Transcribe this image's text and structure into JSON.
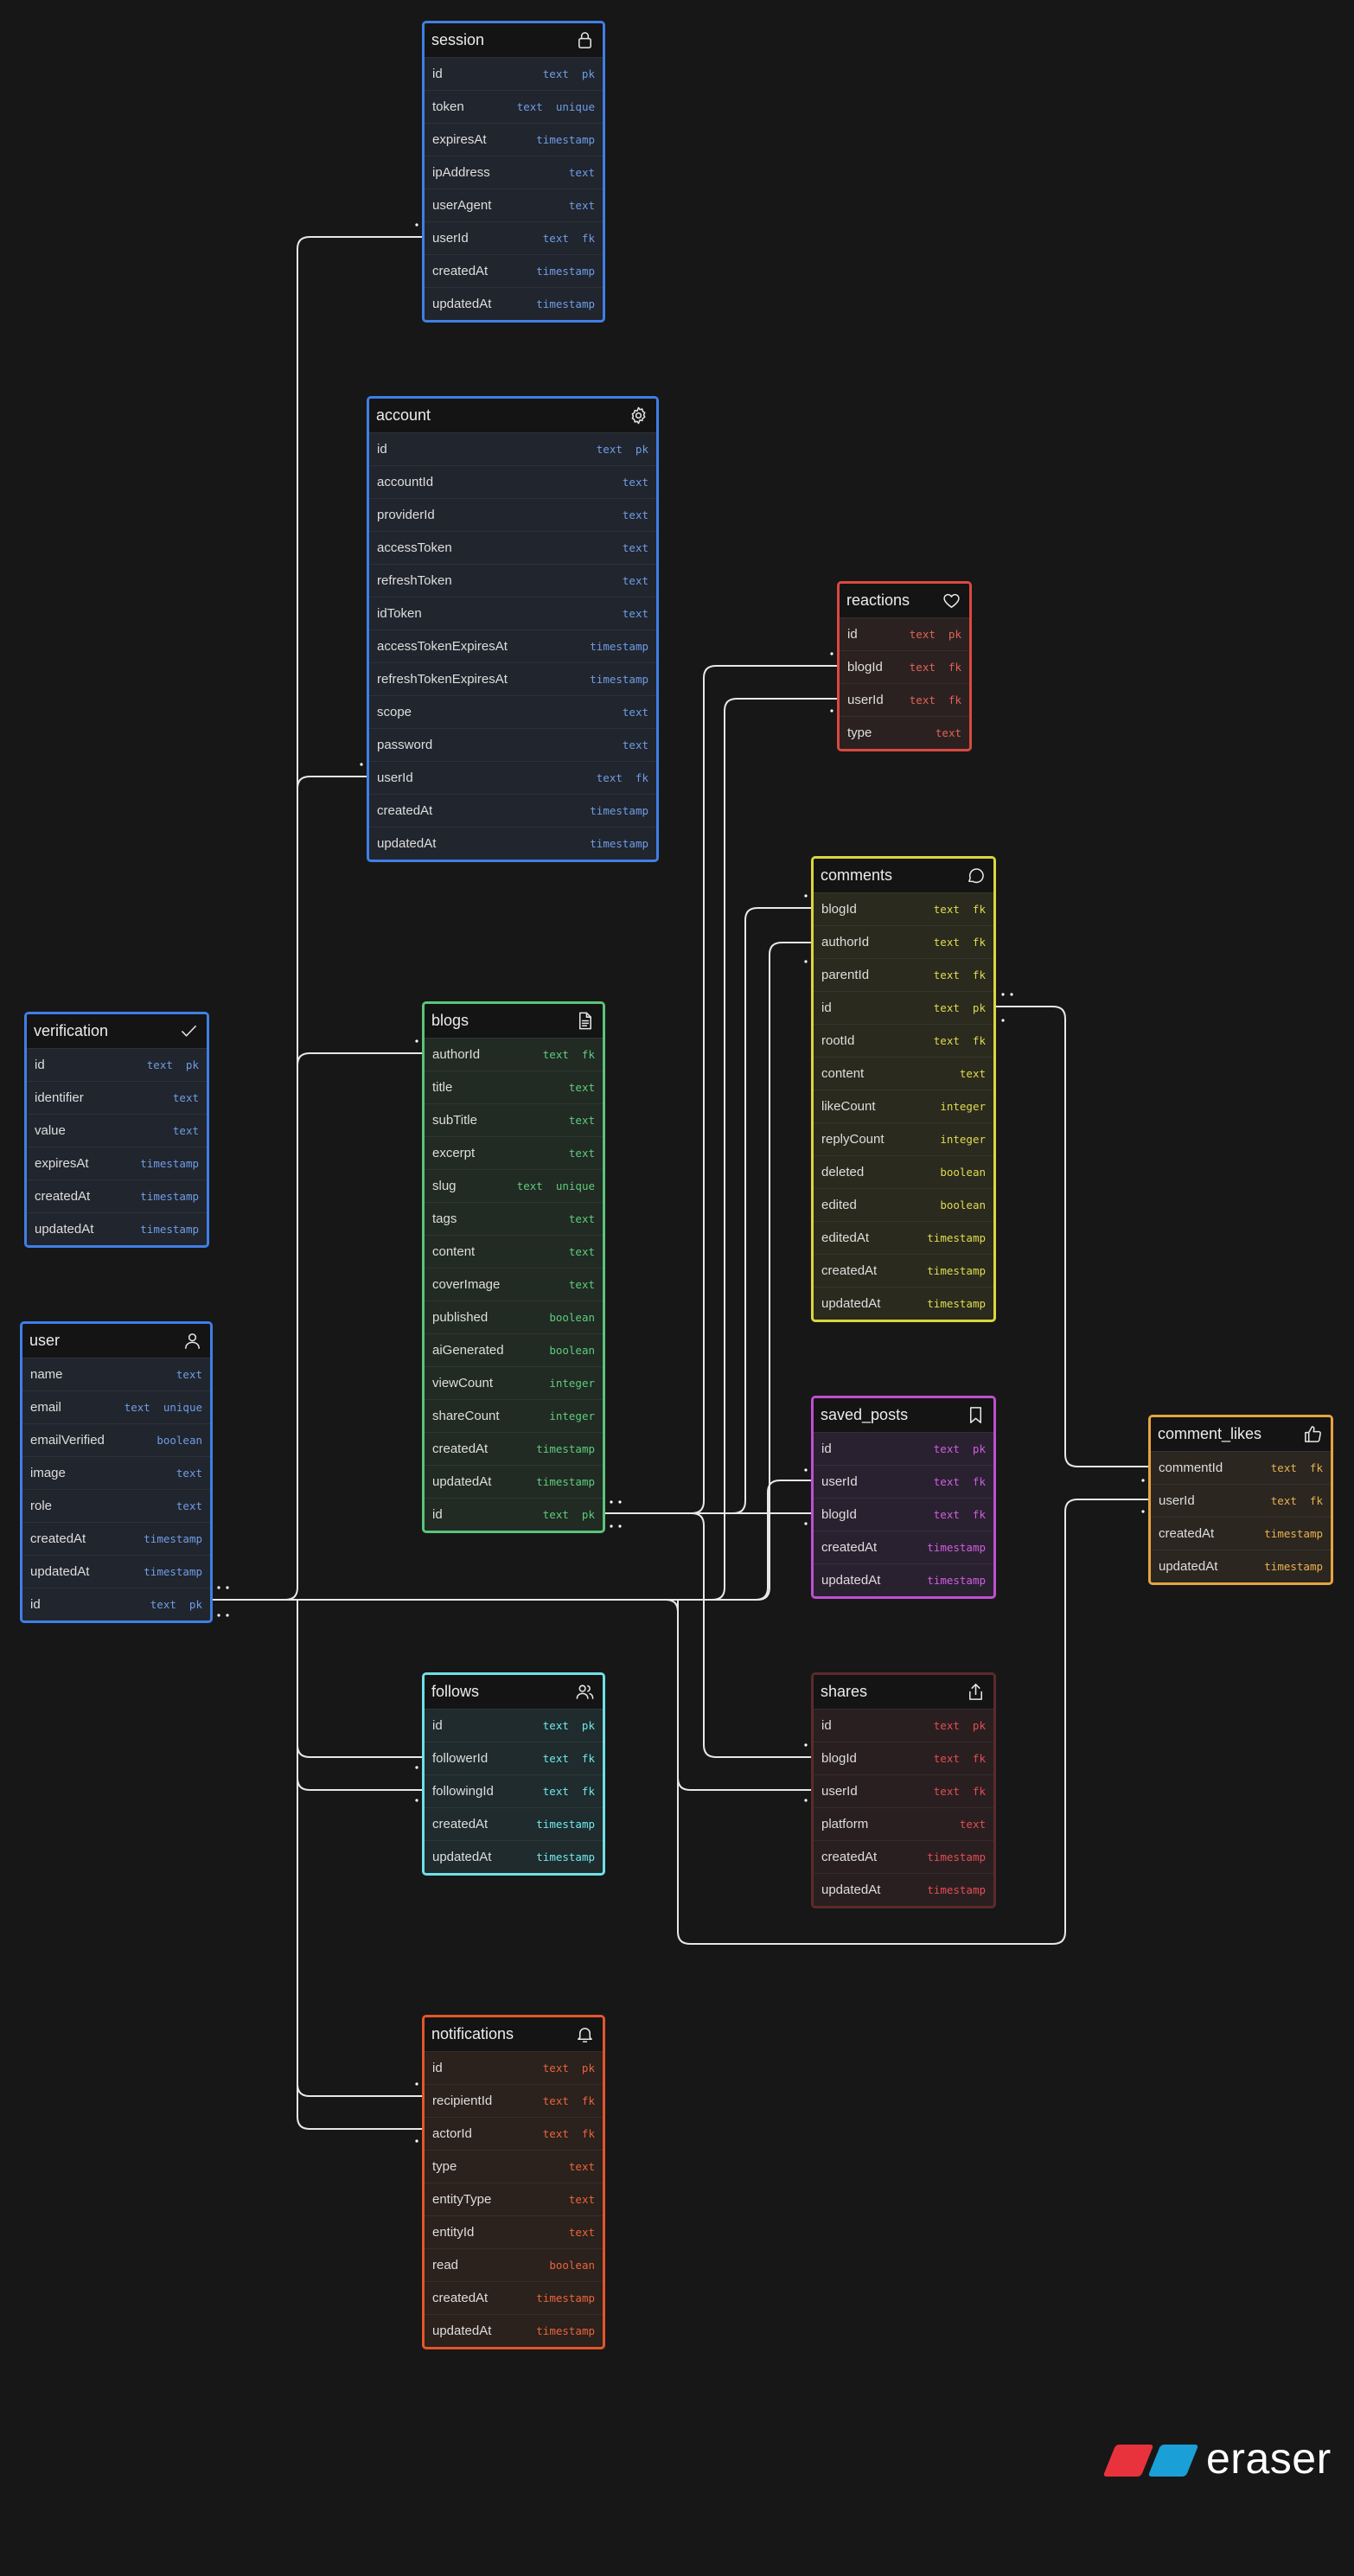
{
  "tables": [
    {
      "id": "session",
      "name": "session",
      "icon": "lock-icon",
      "color": "#3f7fe6",
      "bg": "#21252d",
      "text": "#6e9de8",
      "rows": [
        [
          "id",
          "text  pk"
        ],
        [
          "token",
          "text  unique"
        ],
        [
          "expiresAt",
          "timestamp"
        ],
        [
          "ipAddress",
          "text"
        ],
        [
          "userAgent",
          "text"
        ],
        [
          "userId",
          "text  fk"
        ],
        [
          "createdAt",
          "timestamp"
        ],
        [
          "updatedAt",
          "timestamp"
        ]
      ]
    },
    {
      "id": "account",
      "name": "account",
      "icon": "gear-icon",
      "color": "#3f7fe6",
      "bg": "#21252d",
      "text": "#6e9de8",
      "rows": [
        [
          "id",
          "text  pk"
        ],
        [
          "accountId",
          "text"
        ],
        [
          "providerId",
          "text"
        ],
        [
          "accessToken",
          "text"
        ],
        [
          "refreshToken",
          "text"
        ],
        [
          "idToken",
          "text"
        ],
        [
          "accessTokenExpiresAt",
          "timestamp"
        ],
        [
          "refreshTokenExpiresAt",
          "timestamp"
        ],
        [
          "scope",
          "text"
        ],
        [
          "password",
          "text"
        ],
        [
          "userId",
          "text  fk"
        ],
        [
          "createdAt",
          "timestamp"
        ],
        [
          "updatedAt",
          "timestamp"
        ]
      ]
    },
    {
      "id": "reactions",
      "name": "reactions",
      "icon": "heart-icon",
      "color": "#d9493f",
      "bg": "#2c2121",
      "text": "#e06256",
      "rows": [
        [
          "id",
          "text  pk"
        ],
        [
          "blogId",
          "text  fk"
        ],
        [
          "userId",
          "text  fk"
        ],
        [
          "type",
          "text"
        ]
      ]
    },
    {
      "id": "comments",
      "name": "comments",
      "icon": "speech-bubble-icon",
      "color": "#dbd63c",
      "bg": "#2a2a1e",
      "text": "#e0dc52",
      "rows": [
        [
          "blogId",
          "text  fk"
        ],
        [
          "authorId",
          "text  fk"
        ],
        [
          "parentId",
          "text  fk"
        ],
        [
          "id",
          "text  pk"
        ],
        [
          "rootId",
          "text  fk"
        ],
        [
          "content",
          "text"
        ],
        [
          "likeCount",
          "integer"
        ],
        [
          "replyCount",
          "integer"
        ],
        [
          "deleted",
          "boolean"
        ],
        [
          "edited",
          "boolean"
        ],
        [
          "editedAt",
          "timestamp"
        ],
        [
          "createdAt",
          "timestamp"
        ],
        [
          "updatedAt",
          "timestamp"
        ]
      ]
    },
    {
      "id": "verification",
      "name": "verification",
      "icon": "check-icon",
      "color": "#3f7fe6",
      "bg": "#21252d",
      "text": "#6e9de8",
      "rows": [
        [
          "id",
          "text  pk"
        ],
        [
          "identifier",
          "text"
        ],
        [
          "value",
          "text"
        ],
        [
          "expiresAt",
          "timestamp"
        ],
        [
          "createdAt",
          "timestamp"
        ],
        [
          "updatedAt",
          "timestamp"
        ]
      ]
    },
    {
      "id": "blogs",
      "name": "blogs",
      "icon": "document-icon",
      "color": "#5cc47a",
      "bg": "#222a24",
      "text": "#5dcc7c",
      "rows": [
        [
          "authorId",
          "text  fk"
        ],
        [
          "title",
          "text"
        ],
        [
          "subTitle",
          "text"
        ],
        [
          "excerpt",
          "text"
        ],
        [
          "slug",
          "text  unique"
        ],
        [
          "tags",
          "text"
        ],
        [
          "content",
          "text"
        ],
        [
          "coverImage",
          "text"
        ],
        [
          "published",
          "boolean"
        ],
        [
          "aiGenerated",
          "boolean"
        ],
        [
          "viewCount",
          "integer"
        ],
        [
          "shareCount",
          "integer"
        ],
        [
          "createdAt",
          "timestamp"
        ],
        [
          "updatedAt",
          "timestamp"
        ],
        [
          "id",
          "text  pk"
        ]
      ]
    },
    {
      "id": "user",
      "name": "user",
      "icon": "user-icon",
      "color": "#3f7fe6",
      "bg": "#21252d",
      "text": "#6e9de8",
      "rows": [
        [
          "name",
          "text"
        ],
        [
          "email",
          "text  unique"
        ],
        [
          "emailVerified",
          "boolean"
        ],
        [
          "image",
          "text"
        ],
        [
          "role",
          "text"
        ],
        [
          "createdAt",
          "timestamp"
        ],
        [
          "updatedAt",
          "timestamp"
        ],
        [
          "id",
          "text  pk"
        ]
      ]
    },
    {
      "id": "saved_posts",
      "name": "saved_posts",
      "icon": "bookmark-icon",
      "color": "#c04fd0",
      "bg": "#2a2130",
      "text": "#cf5fe0",
      "rows": [
        [
          "id",
          "text  pk"
        ],
        [
          "userId",
          "text  fk"
        ],
        [
          "blogId",
          "text  fk"
        ],
        [
          "createdAt",
          "timestamp"
        ],
        [
          "updatedAt",
          "timestamp"
        ]
      ]
    },
    {
      "id": "comment_likes",
      "name": "comment_likes",
      "icon": "thumbs-up-icon",
      "color": "#e5a43f",
      "bg": "#2b2620",
      "text": "#e9b152",
      "rows": [
        [
          "commentId",
          "text  fk"
        ],
        [
          "userId",
          "text  fk"
        ],
        [
          "createdAt",
          "timestamp"
        ],
        [
          "updatedAt",
          "timestamp"
        ]
      ]
    },
    {
      "id": "follows",
      "name": "follows",
      "icon": "users-icon",
      "color": "#6fe0e8",
      "bg": "#1f2b2c",
      "text": "#6fe8ee",
      "rows": [
        [
          "id",
          "text  pk"
        ],
        [
          "followerId",
          "text  fk"
        ],
        [
          "followingId",
          "text  fk"
        ],
        [
          "createdAt",
          "timestamp"
        ],
        [
          "updatedAt",
          "timestamp"
        ]
      ]
    },
    {
      "id": "shares",
      "name": "shares",
      "icon": "share-icon",
      "color": "#5c2a2c",
      "bg": "#2a1f20",
      "text": "#e34d55",
      "rows": [
        [
          "id",
          "text  pk"
        ],
        [
          "blogId",
          "text  fk"
        ],
        [
          "userId",
          "text  fk"
        ],
        [
          "platform",
          "text"
        ],
        [
          "createdAt",
          "timestamp"
        ],
        [
          "updatedAt",
          "timestamp"
        ]
      ]
    },
    {
      "id": "notifications",
      "name": "notifications",
      "icon": "bell-icon",
      "color": "#e4562a",
      "bg": "#2b211d",
      "text": "#e9653b",
      "rows": [
        [
          "id",
          "text  pk"
        ],
        [
          "recipientId",
          "text  fk"
        ],
        [
          "actorId",
          "text  fk"
        ],
        [
          "type",
          "text"
        ],
        [
          "entityType",
          "text"
        ],
        [
          "entityId",
          "text"
        ],
        [
          "read",
          "boolean"
        ],
        [
          "createdAt",
          "timestamp"
        ],
        [
          "updatedAt",
          "timestamp"
        ]
      ]
    }
  ],
  "branding": {
    "wordmark": "eraser"
  }
}
